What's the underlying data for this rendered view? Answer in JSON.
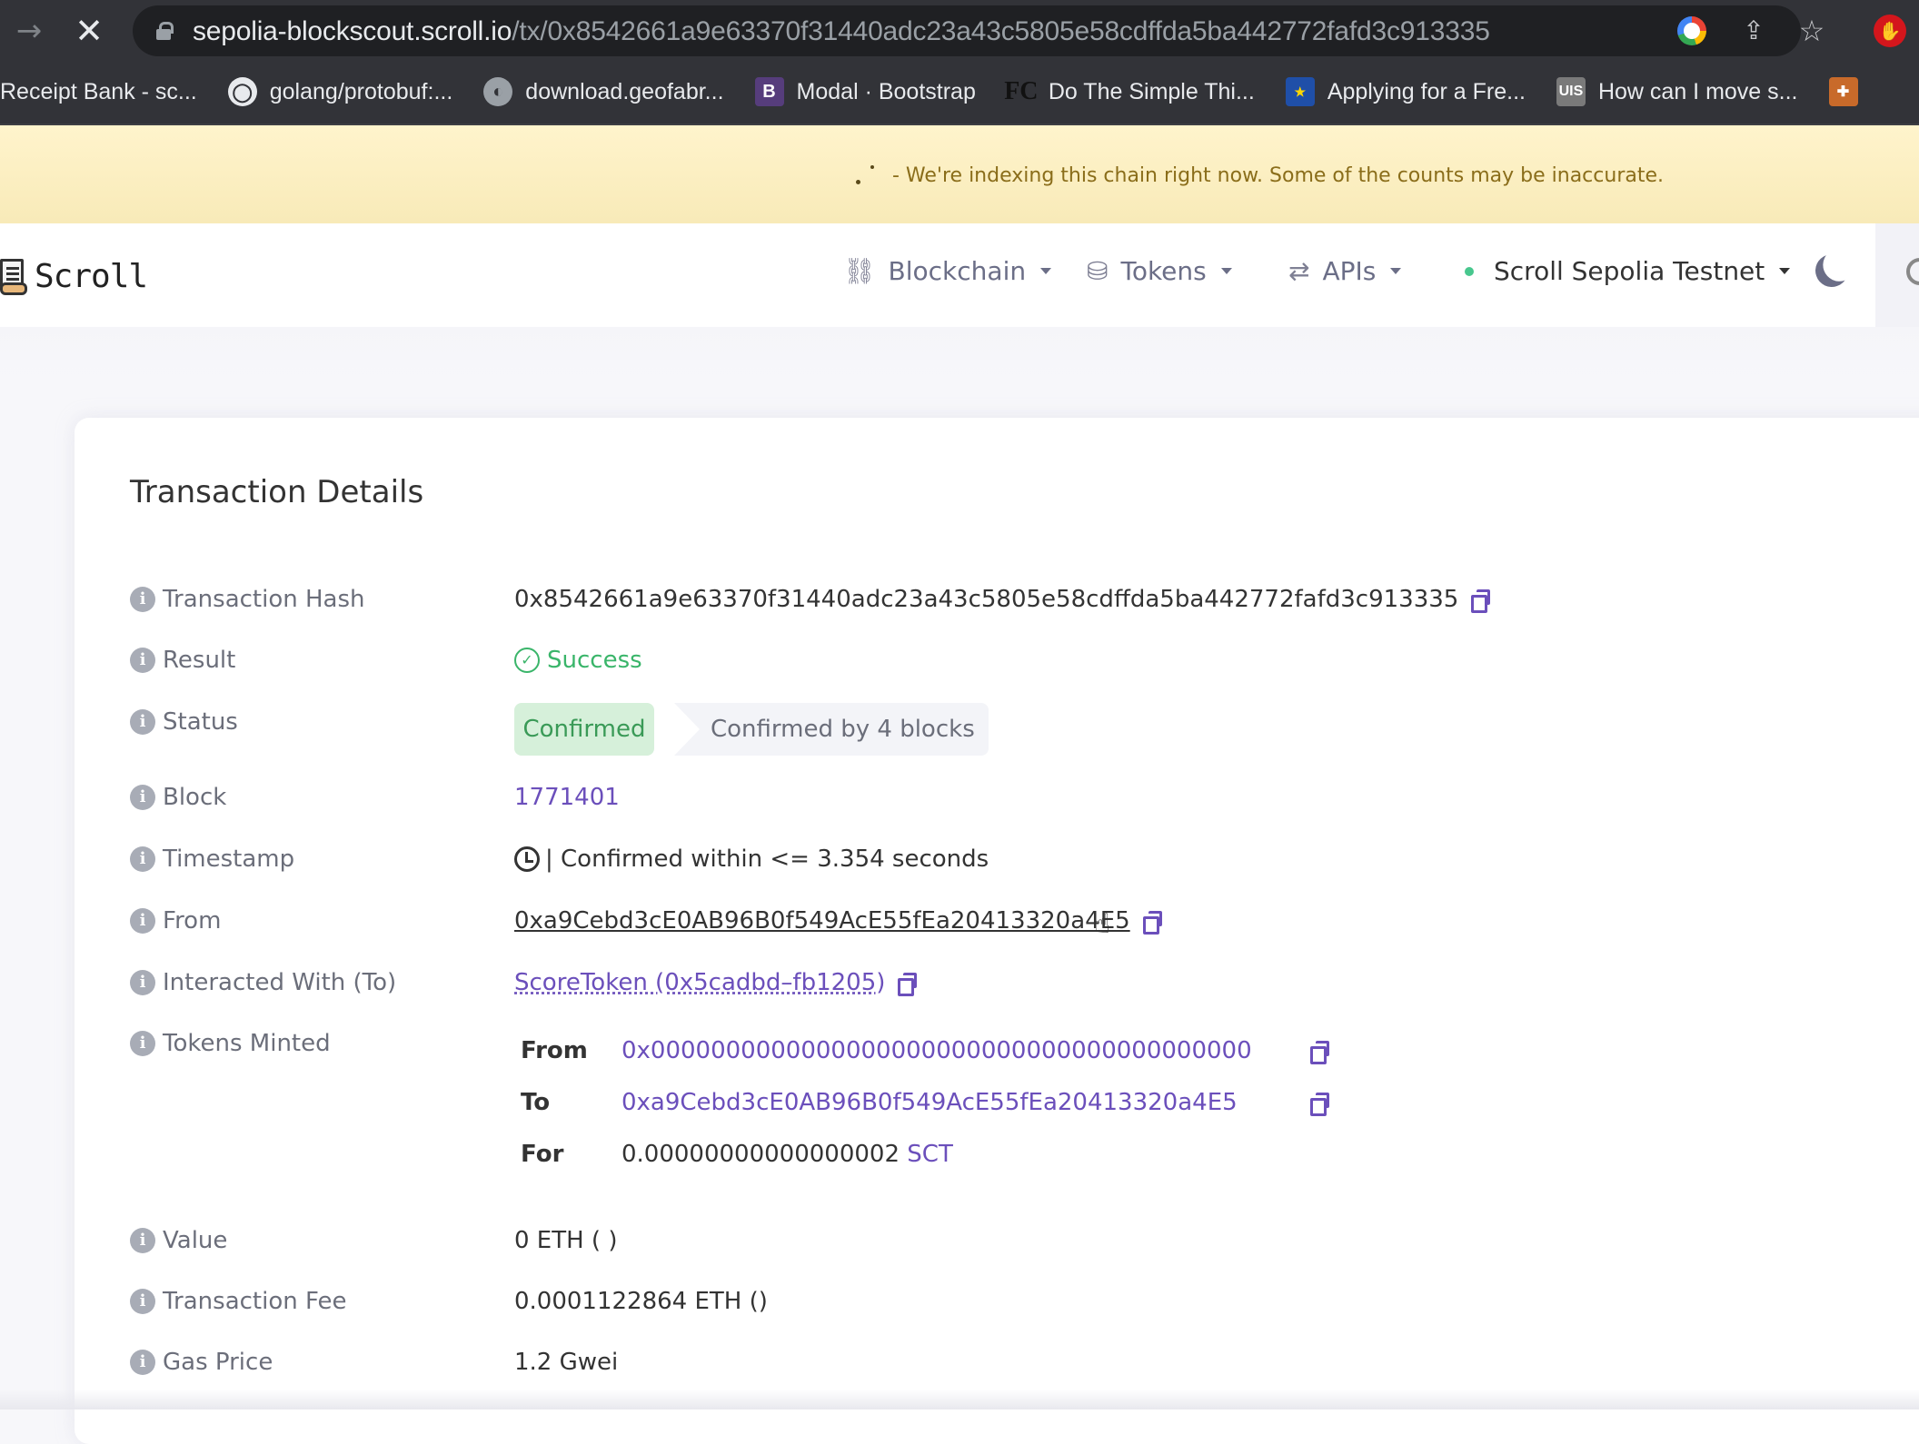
{
  "browser": {
    "url_host": "sepolia-blockscout.scroll.io",
    "url_path": "/tx/0x8542661a9e63370f31440adc23a43c5805e58cdffda5ba442772fafd3c913335",
    "forward_icon": "→",
    "stop_icon": "✕",
    "share_icon": "⇪",
    "star_icon": "☆",
    "extension_icon": "✋",
    "bookmarks": [
      {
        "label": "Receipt Bank - sc...",
        "icon": ""
      },
      {
        "label": "golang/protobuf:...",
        "icon": "◯"
      },
      {
        "label": "download.geofabr...",
        "icon": "◐"
      },
      {
        "label": "Modal · Bootstrap",
        "icon": "B"
      },
      {
        "label": "Do The Simple Thi...",
        "icon": "FC"
      },
      {
        "label": "Applying for a Fre...",
        "icon": "★"
      },
      {
        "label": "How can I move s...",
        "icon": "UIS"
      },
      {
        "label": "",
        "icon": "✚"
      }
    ]
  },
  "banner": {
    "text": "- We're indexing this chain right now. Some of the counts may be inaccurate."
  },
  "header": {
    "logo_text": "Scroll",
    "nav": [
      {
        "label": "Blockchain",
        "icon": "🔗"
      },
      {
        "label": "Tokens",
        "icon": "⛁"
      },
      {
        "label": "APIs",
        "icon": "⇄"
      }
    ],
    "network": "Scroll Sepolia Testnet",
    "colors": {
      "network_dot": "#48c78e",
      "link": "#6b4fbb",
      "success": "#3ab56a"
    }
  },
  "card": {
    "title": "Transaction Details",
    "info_icon": "i",
    "rows": {
      "tx_hash": {
        "label": "Transaction Hash",
        "value": "0x8542661a9e63370f31440adc23a43c5805e58cdffda5ba442772fafd3c913335"
      },
      "result": {
        "label": "Result",
        "value": "Success",
        "icon": "✓"
      },
      "status": {
        "label": "Status",
        "badge": "Confirmed",
        "confirmations": "Confirmed by 4 blocks"
      },
      "block": {
        "label": "Block",
        "value": "1771401"
      },
      "timestamp": {
        "label": "Timestamp",
        "value": "| Confirmed within <= 3.354 seconds"
      },
      "from": {
        "label": "From",
        "value": "0xa9Cebd3cE0AB96B0f549AcE55fEa20413320a4E5"
      },
      "to": {
        "label": "Interacted With (To)",
        "value": "ScoreToken (0x5cadbd–fb1205)"
      },
      "tokens_minted": {
        "label": "Tokens Minted",
        "from_label": "From",
        "from_value": "0x0000000000000000000000000000000000000000",
        "to_label": "To",
        "to_value": "0xa9Cebd3cE0AB96B0f549AcE55fEa20413320a4E5",
        "for_label": "For",
        "for_amount": "0.00000000000000002",
        "for_token": "SCT"
      },
      "value": {
        "label": "Value",
        "value": "0 ETH ( )"
      },
      "fee": {
        "label": "Transaction Fee",
        "value": "0.0001122864 ETH ()"
      },
      "gas_price": {
        "label": "Gas Price",
        "value": "1.2 Gwei"
      }
    }
  }
}
